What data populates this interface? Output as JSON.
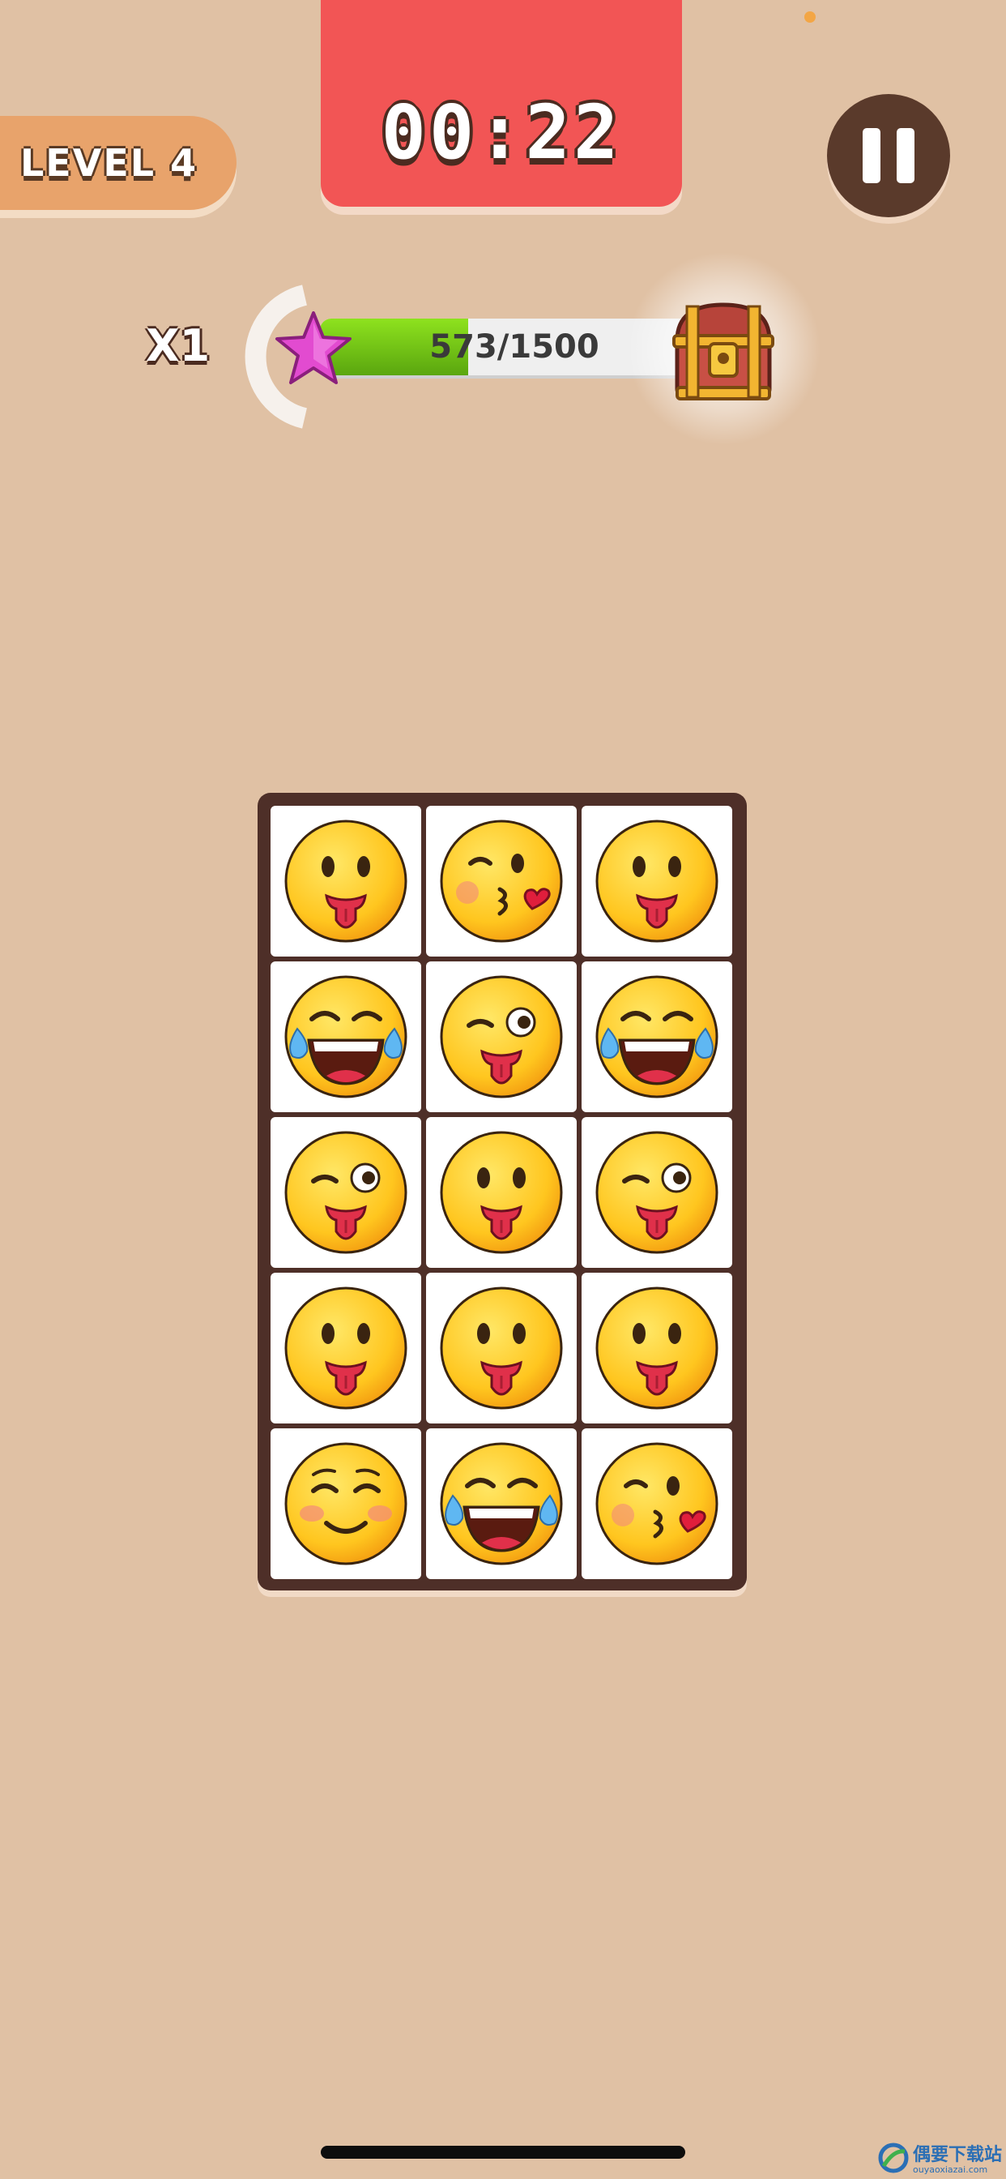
{
  "header": {
    "level_label": "LEVEL 4",
    "timer": "00:22"
  },
  "progress": {
    "multiplier": "X1",
    "current": 573,
    "target": 1500,
    "label": "573/1500"
  },
  "colors": {
    "background": "#e0c1a4",
    "level_pill": "#e8a36b",
    "timer_box": "#f25555",
    "pause_button": "#5a3a2b",
    "board": "#4e2f28",
    "progress_fill": "#6cc014",
    "star": "#e24bd0"
  },
  "icons": {
    "pause": "pause-icon",
    "star": "star-icon",
    "chest": "treasure-chest-icon"
  },
  "board": {
    "rows": 5,
    "cols": 3,
    "tiles": [
      "tongue",
      "kiss-heart",
      "tongue",
      "tears-of-joy",
      "wink-tongue",
      "tears-of-joy",
      "wink-tongue",
      "tongue",
      "wink-tongue",
      "tongue",
      "tongue",
      "tongue",
      "smiling-blush",
      "tears-of-joy",
      "kiss-heart"
    ]
  },
  "watermark": {
    "title": "偶要下载站",
    "subtitle": "ouyaoxiazai.com"
  }
}
